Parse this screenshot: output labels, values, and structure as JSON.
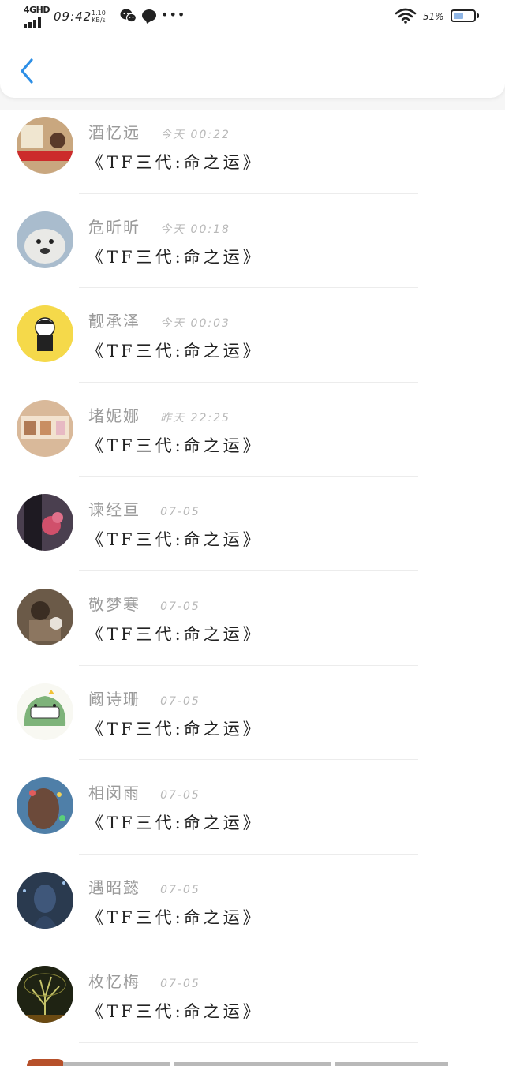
{
  "status_bar": {
    "network": "4GHD",
    "time": "09:42",
    "speed_value": "1.10",
    "speed_unit": "KB/s",
    "battery_percent": "51%",
    "battery_level": 0.51,
    "icons": [
      "signal-icon",
      "wechat-icon",
      "message-icon",
      "more-dots-icon",
      "wifi-icon",
      "battery-icon"
    ]
  },
  "header": {
    "back_icon": "chevron-left-icon",
    "accent_color": "#2d8fe6"
  },
  "list": [
    {
      "name": "酒忆远",
      "time": "今天 00:22",
      "title": "《TF三代:命之运》",
      "avatar_color": "#c9a77f"
    },
    {
      "name": "危昕昕",
      "time": "今天 00:18",
      "title": "《TF三代:命之运》",
      "avatar_color": "#8fa3b5"
    },
    {
      "name": "靓承泽",
      "time": "今天 00:03",
      "title": "《TF三代:命之运》",
      "avatar_color": "#f5d94a"
    },
    {
      "name": "堵妮娜",
      "time": "昨天 22:25",
      "title": "《TF三代:命之运》",
      "avatar_color": "#d9b99a"
    },
    {
      "name": "谏经亘",
      "time": "07-05",
      "title": "《TF三代:命之运》",
      "avatar_color": "#4a3f4f"
    },
    {
      "name": "敬梦寒",
      "time": "07-05",
      "title": "《TF三代:命之运》",
      "avatar_color": "#6b5a48"
    },
    {
      "name": "阚诗珊",
      "time": "07-05",
      "title": "《TF三代:命之运》",
      "avatar_color": "#f4f2e6"
    },
    {
      "name": "相闵雨",
      "time": "07-05",
      "title": "《TF三代:命之运》",
      "avatar_color": "#6c4a3a"
    },
    {
      "name": "遇昭懿",
      "time": "07-05",
      "title": "《TF三代:命之运》",
      "avatar_color": "#2a3a4f"
    },
    {
      "name": "枚忆梅",
      "time": "07-05",
      "title": "《TF三代:命之运》",
      "avatar_color": "#1f2313"
    }
  ]
}
